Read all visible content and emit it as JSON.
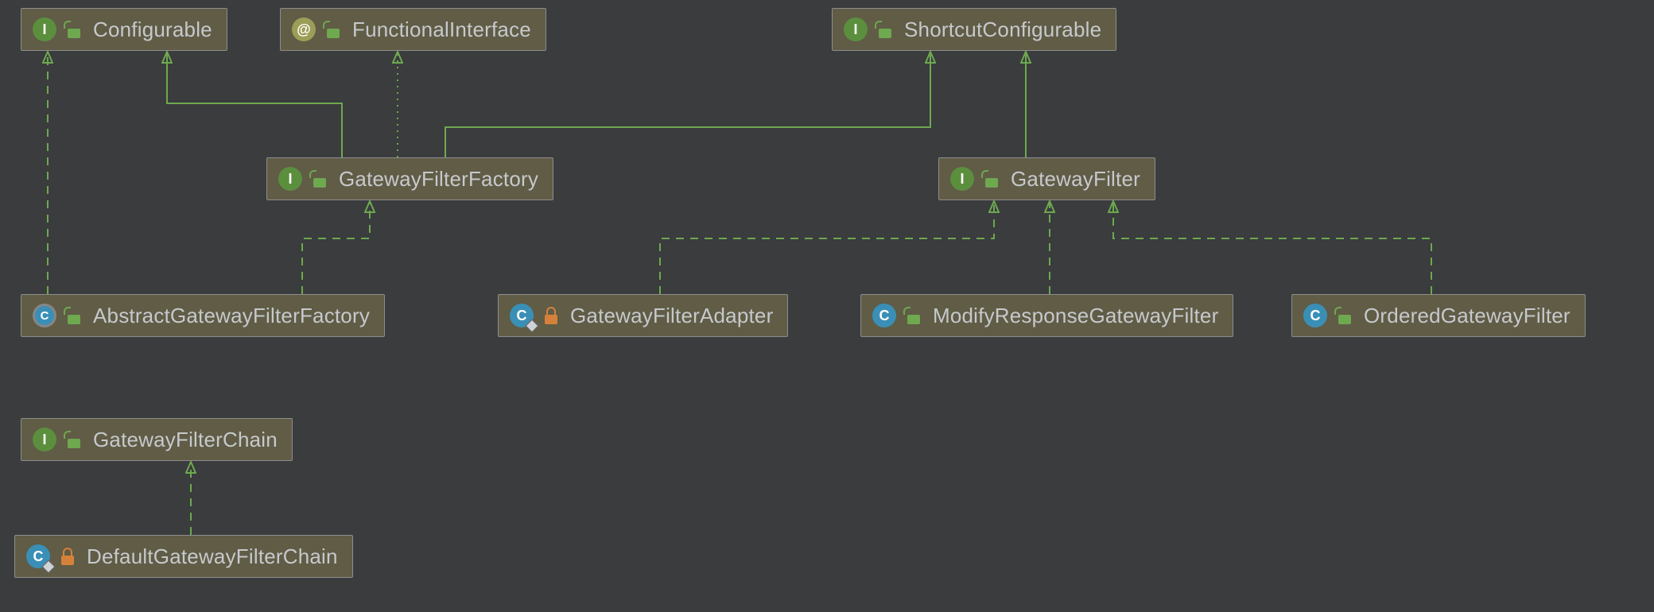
{
  "colors": {
    "background": "#3a3c3e",
    "node_fill": "#605c46",
    "node_border": "#8d8d8d",
    "edge": "#6ea84f",
    "text": "#c6c9cc",
    "kind_interface": "#5b8f3e",
    "kind_class": "#3a8fb7",
    "kind_annotation": "#9c9d57",
    "lock_open": "#6ea84f",
    "lock_closed": "#d6813b"
  },
  "nodes": {
    "configurable": {
      "label": "Configurable",
      "kind": "I",
      "lock": "open"
    },
    "functionalInterface": {
      "label": "FunctionalInterface",
      "kind": "@",
      "lock": "open"
    },
    "shortcutConfigurable": {
      "label": "ShortcutConfigurable",
      "kind": "I",
      "lock": "open"
    },
    "gatewayFilterFactory": {
      "label": "GatewayFilterFactory",
      "kind": "I",
      "lock": "open"
    },
    "gatewayFilter": {
      "label": "GatewayFilter",
      "kind": "I",
      "lock": "open"
    },
    "abstractGatewayFilterFactory": {
      "label": "AbstractGatewayFilterFactory",
      "kind": "AC",
      "lock": "open"
    },
    "gatewayFilterAdapter": {
      "label": "GatewayFilterAdapter",
      "kind": "C",
      "lock": "closed",
      "corner": true
    },
    "modifyResponseGatewayFilter": {
      "label": "ModifyResponseGatewayFilter",
      "kind": "C",
      "lock": "open"
    },
    "orderedGatewayFilter": {
      "label": "OrderedGatewayFilter",
      "kind": "C",
      "lock": "open"
    },
    "gatewayFilterChain": {
      "label": "GatewayFilterChain",
      "kind": "I",
      "lock": "open"
    },
    "defaultGatewayFilterChain": {
      "label": "DefaultGatewayFilterChain",
      "kind": "C",
      "lock": "closed",
      "corner": true
    }
  },
  "edges": [
    {
      "from": "gatewayFilterFactory",
      "to": "configurable",
      "style": "solid"
    },
    {
      "from": "gatewayFilterFactory",
      "to": "functionalInterface",
      "style": "dotted"
    },
    {
      "from": "gatewayFilterFactory",
      "to": "shortcutConfigurable",
      "style": "solid"
    },
    {
      "from": "gatewayFilter",
      "to": "shortcutConfigurable",
      "style": "solid"
    },
    {
      "from": "abstractGatewayFilterFactory",
      "to": "configurable",
      "style": "dashed"
    },
    {
      "from": "abstractGatewayFilterFactory",
      "to": "gatewayFilterFactory",
      "style": "dashed"
    },
    {
      "from": "gatewayFilterAdapter",
      "to": "gatewayFilter",
      "style": "dashed"
    },
    {
      "from": "modifyResponseGatewayFilter",
      "to": "gatewayFilter",
      "style": "dashed"
    },
    {
      "from": "orderedGatewayFilter",
      "to": "gatewayFilter",
      "style": "dashed"
    },
    {
      "from": "defaultGatewayFilterChain",
      "to": "gatewayFilterChain",
      "style": "dashed"
    }
  ]
}
